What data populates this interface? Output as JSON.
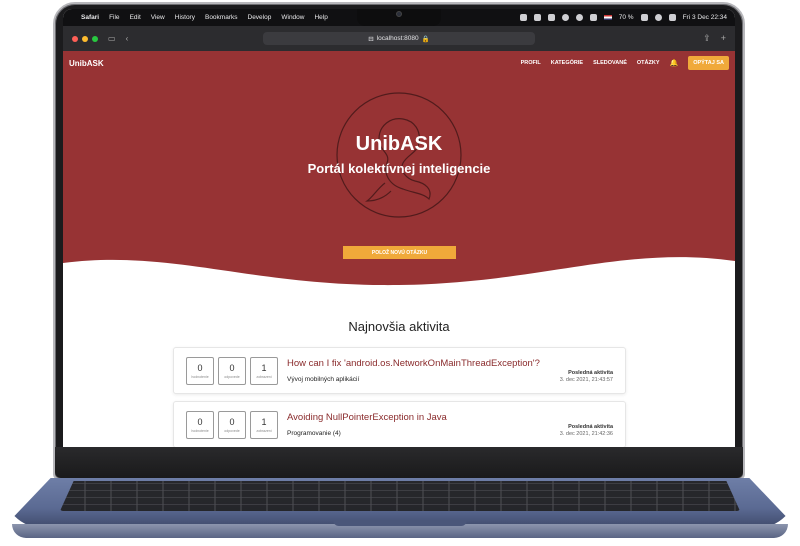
{
  "menubar": {
    "app": "Safari",
    "items": [
      "File",
      "Edit",
      "View",
      "History",
      "Bookmarks",
      "Develop",
      "Window",
      "Help"
    ],
    "battery": "70 %",
    "clock": "Fri 3 Dec  22:34"
  },
  "browser": {
    "url": "localhost:8080"
  },
  "nav": {
    "brand": "UnibASK",
    "links": [
      "PROFIL",
      "KATEGÓRIE",
      "SLEDOVANÉ",
      "OTÁZKY"
    ],
    "ask_button": "OPÝTAJ SA"
  },
  "hero": {
    "title": "UnibASK",
    "subtitle": "Portál kolektívnej inteligencie",
    "cta": "POLOŽ NOVÚ OTÁZKU"
  },
  "activity": {
    "heading": "Najnovšia aktivita",
    "questions": [
      {
        "title": "How can I fix 'android.os.NetworkOnMainThreadException'?",
        "category": "Vývoj mobilných aplikácií",
        "votes": "0",
        "votes_label": "hodnotenie",
        "answers": "0",
        "answers_label": "odpovede",
        "views": "1",
        "views_label": "zobrazení",
        "activity_label": "Posledná aktivita",
        "date": "3. dec 2021, 21:43:57"
      },
      {
        "title": "Avoiding NullPointerException in Java",
        "category": "Programovanie (4)",
        "votes": "0",
        "votes_label": "hodnotenie",
        "answers": "0",
        "answers_label": "odpovede",
        "views": "1",
        "views_label": "zobrazení",
        "activity_label": "Posledná aktivita",
        "date": "3. dec 2021, 21:42:36"
      }
    ]
  },
  "colors": {
    "primary": "#973334",
    "accent": "#f0a93a",
    "link": "#8a2b2c"
  }
}
